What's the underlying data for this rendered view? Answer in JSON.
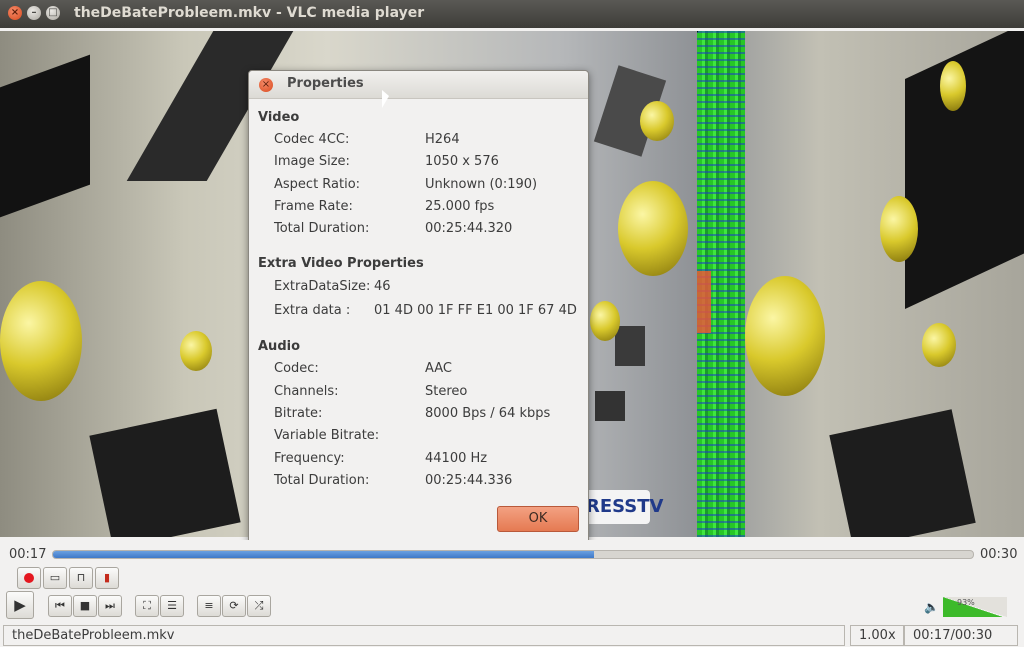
{
  "window": {
    "title": "theDeBateProbleem.mkv - VLC media player",
    "close_glyph": "×",
    "min_glyph": "–",
    "max_glyph": "□"
  },
  "video": {
    "watermark": "RESSTV"
  },
  "dialog": {
    "title": "Properties",
    "close_glyph": "×",
    "sections": {
      "video": {
        "title": "Video",
        "rows": [
          {
            "label": "Codec 4CC:",
            "value": "H264"
          },
          {
            "label": "Image Size:",
            "value": "1050 x 576"
          },
          {
            "label": "Aspect Ratio:",
            "value": "Unknown (0:190)"
          },
          {
            "label": "Frame Rate:",
            "value": "25.000 fps"
          },
          {
            "label": "Total Duration:",
            "value": "00:25:44.320"
          }
        ]
      },
      "extra": {
        "title": "Extra Video Properties",
        "rows": [
          {
            "label": "ExtraDataSize:",
            "value": "46"
          },
          {
            "label": "Extra data :",
            "value": "01 4D 00 1F FF E1 00 1F 67 4D"
          }
        ]
      },
      "audio": {
        "title": "Audio",
        "rows": [
          {
            "label": "Codec:",
            "value": "AAC"
          },
          {
            "label": "Channels:",
            "value": "Stereo"
          },
          {
            "label": "Bitrate:",
            "value": "8000 Bps / 64 kbps"
          },
          {
            "label": "Variable Bitrate:",
            "value": ""
          },
          {
            "label": "Frequency:",
            "value": "44100 Hz"
          },
          {
            "label": "Total Duration:",
            "value": "00:25:44.336"
          }
        ]
      }
    },
    "ok_label": "OK"
  },
  "controls": {
    "elapsed": "00:17",
    "total": "00:30",
    "progress_fraction": 0.588,
    "volume_label": "93%",
    "volume_fraction": 0.93,
    "icons": {
      "record": "record-icon",
      "snapshot": "snapshot-icon",
      "loop_ab": "ab-loop-icon",
      "frame_step": "frame-by-frame-icon",
      "play": "▶",
      "prev": "⏮",
      "stop": "■",
      "next": "⏭",
      "fullscreen": "⛶",
      "extended": "☰",
      "playlist": "≡",
      "loop": "⟳",
      "shuffle": "⤮",
      "volume": "🔈"
    }
  },
  "status": {
    "filename": "theDeBateProbleem.mkv",
    "speed": "1.00x",
    "time": "00:17/00:30"
  },
  "colors": {
    "accent": "#e57a52",
    "progress": "#3f79c8",
    "volume": "#3dba2a"
  }
}
